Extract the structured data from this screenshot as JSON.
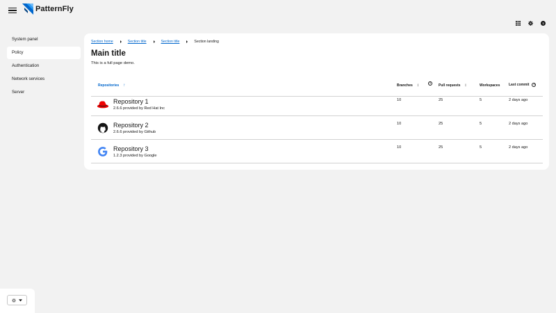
{
  "masthead": {
    "brand": "PatternFly",
    "tools": [
      "apps-grid-icon",
      "gear-icon",
      "help-icon"
    ]
  },
  "sidebar": {
    "items": [
      {
        "label": "System panel",
        "active": false
      },
      {
        "label": "Policy",
        "active": true
      },
      {
        "label": "Authentication",
        "active": false
      },
      {
        "label": "Network services",
        "active": false
      },
      {
        "label": "Server",
        "active": false
      }
    ],
    "theme_toggle_icon": "sun-icon"
  },
  "breadcrumb": {
    "items": [
      "Section home",
      "Section title",
      "Section title"
    ],
    "current": "Section landing"
  },
  "main": {
    "title": "Main title",
    "description": "This is a full page demo."
  },
  "table": {
    "headers": {
      "repositories": "Repositories",
      "branches": "Branches",
      "pull_requests": "Pull requests",
      "workspaces": "Workspaces",
      "last_commit": "Last commit"
    },
    "rows": [
      {
        "icon": "redhat-icon",
        "name": "Repository 1",
        "sub": "2.6.6 provided by Red Hat Inc",
        "branches": "10",
        "pull_requests": "25",
        "workspaces": "5",
        "last_commit": "2 days ago"
      },
      {
        "icon": "github-icon",
        "name": "Repository 2",
        "sub": "2.6.6 provided by Github",
        "branches": "10",
        "pull_requests": "25",
        "workspaces": "5",
        "last_commit": "2 days ago"
      },
      {
        "icon": "google-icon",
        "name": "Repository 3",
        "sub": "1.2.3 provided by Google",
        "branches": "10",
        "pull_requests": "25",
        "workspaces": "5",
        "last_commit": "2 days ago"
      }
    ]
  },
  "colors": {
    "link": "#0066cc",
    "background": "#f2f2f2",
    "card": "#ffffff",
    "brand_blue": "#2b9af3",
    "redhat_red": "#ee0000"
  }
}
